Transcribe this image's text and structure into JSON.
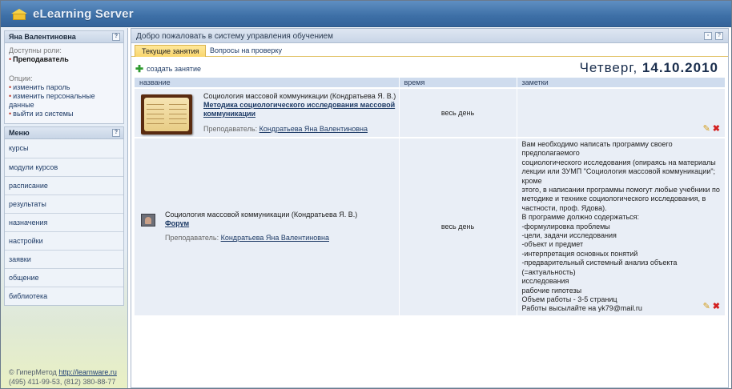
{
  "app": {
    "title": "eLearning Server",
    "logo_icon": "house-icon"
  },
  "sidebar": {
    "user_block": {
      "user_name": "Яна Валентиновна",
      "roles_label": "Доступны роли:",
      "role": "Преподаватель",
      "options_label": "Опции:",
      "options": [
        "изменить пароль",
        "изменить персональные данные",
        "выйти из системы"
      ]
    },
    "menu": {
      "title": "Меню",
      "items": [
        "курсы",
        "модули курсов",
        "расписание",
        "результаты",
        "назначения",
        "настройки",
        "заявки",
        "общение",
        "библиотека"
      ]
    }
  },
  "footer": {
    "copyright_prefix": "© ГиперМетод",
    "link": "http://learnware.ru",
    "phones": "(495) 411-99-53, (812) 380-88-77"
  },
  "main": {
    "title": "Добро пожаловать в систему управления обучением",
    "tabs": [
      "Текущие занятия",
      "Вопросы на проверку"
    ],
    "create_label": "создать занятие",
    "date_day": "Четверг,",
    "date_value": "14.10.2010",
    "columns": [
      "название",
      "время",
      "заметки"
    ],
    "rows": [
      {
        "course": "Социология массовой коммуникации (Кондратьева Я. В.)",
        "lesson": "Методика социологического исследования массовой коммуникации",
        "teacher_label": "Преподаватель:",
        "teacher": "Кондратьева Яна Валентиновна",
        "time": "весь день",
        "notes": []
      },
      {
        "course": "Социология массовой коммуникации (Кондратьева Я. В.)",
        "lesson": "Форум",
        "teacher_label": "Преподаватель:",
        "teacher": "Кондратьева Яна Валентиновна",
        "time": "весь день",
        "notes": [
          "Вам необходимо написать программу своего предполагаемого",
          "социологического исследования (опираясь на материалы",
          "лекции или ЗУМП \"Социология массовой коммуникации\"; кроме",
          "этого, в написании программы помогут любые учебники по",
          "методике и технике социологического исследования, в",
          "частности, проф. Ядова).",
          "В программе должно содержаться:",
          "-формулировка проблемы",
          "-цели, задачи исследования",
          "-объект и предмет",
          "-интерпретация основных понятий",
          "-предварительный системный анализ объекта (=актуальность)",
          "исследования",
          "рабочие гипотезы",
          "Объем работы - 3-5 страниц",
          "Работы высылайте на yk79@mail.ru"
        ]
      }
    ]
  },
  "colors": {
    "header_blue": "#3d6fa6",
    "active_tab": "#f9d66c",
    "delete_red": "#d32020",
    "add_green": "#2f9a2f"
  }
}
